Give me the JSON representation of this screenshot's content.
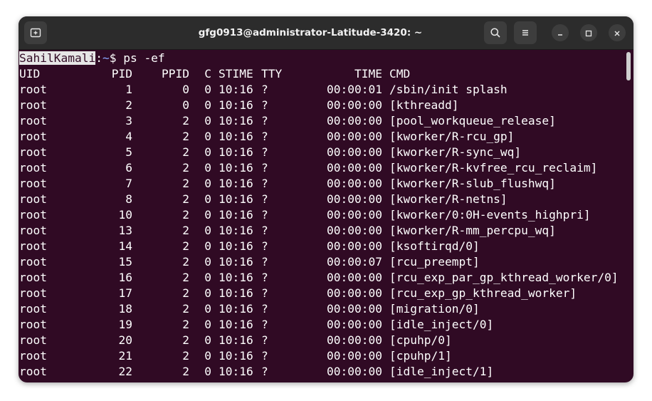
{
  "window": {
    "title": "gfg0913@administrator-Latitude-3420: ~"
  },
  "prompt": {
    "user": "SahilKamali",
    "sep": ":",
    "path": "~",
    "symbol": "$ ",
    "command": "ps -ef"
  },
  "table": {
    "headers": {
      "uid": "UID",
      "pid": "PID",
      "ppid": "PPID",
      "c": "C",
      "stime": "STIME",
      "tty": "TTY",
      "time": "TIME",
      "cmd": "CMD"
    },
    "rows": [
      {
        "uid": "root",
        "pid": "1",
        "ppid": "0",
        "c": "0",
        "stime": "10:16",
        "tty": "?",
        "time": "00:00:01",
        "cmd": "/sbin/init splash"
      },
      {
        "uid": "root",
        "pid": "2",
        "ppid": "0",
        "c": "0",
        "stime": "10:16",
        "tty": "?",
        "time": "00:00:00",
        "cmd": "[kthreadd]"
      },
      {
        "uid": "root",
        "pid": "3",
        "ppid": "2",
        "c": "0",
        "stime": "10:16",
        "tty": "?",
        "time": "00:00:00",
        "cmd": "[pool_workqueue_release]"
      },
      {
        "uid": "root",
        "pid": "4",
        "ppid": "2",
        "c": "0",
        "stime": "10:16",
        "tty": "?",
        "time": "00:00:00",
        "cmd": "[kworker/R-rcu_gp]"
      },
      {
        "uid": "root",
        "pid": "5",
        "ppid": "2",
        "c": "0",
        "stime": "10:16",
        "tty": "?",
        "time": "00:00:00",
        "cmd": "[kworker/R-sync_wq]"
      },
      {
        "uid": "root",
        "pid": "6",
        "ppid": "2",
        "c": "0",
        "stime": "10:16",
        "tty": "?",
        "time": "00:00:00",
        "cmd": "[kworker/R-kvfree_rcu_reclaim]"
      },
      {
        "uid": "root",
        "pid": "7",
        "ppid": "2",
        "c": "0",
        "stime": "10:16",
        "tty": "?",
        "time": "00:00:00",
        "cmd": "[kworker/R-slub_flushwq]"
      },
      {
        "uid": "root",
        "pid": "8",
        "ppid": "2",
        "c": "0",
        "stime": "10:16",
        "tty": "?",
        "time": "00:00:00",
        "cmd": "[kworker/R-netns]"
      },
      {
        "uid": "root",
        "pid": "10",
        "ppid": "2",
        "c": "0",
        "stime": "10:16",
        "tty": "?",
        "time": "00:00:00",
        "cmd": "[kworker/0:0H-events_highpri]"
      },
      {
        "uid": "root",
        "pid": "13",
        "ppid": "2",
        "c": "0",
        "stime": "10:16",
        "tty": "?",
        "time": "00:00:00",
        "cmd": "[kworker/R-mm_percpu_wq]"
      },
      {
        "uid": "root",
        "pid": "14",
        "ppid": "2",
        "c": "0",
        "stime": "10:16",
        "tty": "?",
        "time": "00:00:00",
        "cmd": "[ksoftirqd/0]"
      },
      {
        "uid": "root",
        "pid": "15",
        "ppid": "2",
        "c": "0",
        "stime": "10:16",
        "tty": "?",
        "time": "00:00:07",
        "cmd": "[rcu_preempt]"
      },
      {
        "uid": "root",
        "pid": "16",
        "ppid": "2",
        "c": "0",
        "stime": "10:16",
        "tty": "?",
        "time": "00:00:00",
        "cmd": "[rcu_exp_par_gp_kthread_worker/0]"
      },
      {
        "uid": "root",
        "pid": "17",
        "ppid": "2",
        "c": "0",
        "stime": "10:16",
        "tty": "?",
        "time": "00:00:00",
        "cmd": "[rcu_exp_gp_kthread_worker]"
      },
      {
        "uid": "root",
        "pid": "18",
        "ppid": "2",
        "c": "0",
        "stime": "10:16",
        "tty": "?",
        "time": "00:00:00",
        "cmd": "[migration/0]"
      },
      {
        "uid": "root",
        "pid": "19",
        "ppid": "2",
        "c": "0",
        "stime": "10:16",
        "tty": "?",
        "time": "00:00:00",
        "cmd": "[idle_inject/0]"
      },
      {
        "uid": "root",
        "pid": "20",
        "ppid": "2",
        "c": "0",
        "stime": "10:16",
        "tty": "?",
        "time": "00:00:00",
        "cmd": "[cpuhp/0]"
      },
      {
        "uid": "root",
        "pid": "21",
        "ppid": "2",
        "c": "0",
        "stime": "10:16",
        "tty": "?",
        "time": "00:00:00",
        "cmd": "[cpuhp/1]"
      },
      {
        "uid": "root",
        "pid": "22",
        "ppid": "2",
        "c": "0",
        "stime": "10:16",
        "tty": "?",
        "time": "00:00:00",
        "cmd": "[idle_inject/1]"
      }
    ]
  },
  "icons": {
    "new_tab": "new-tab-icon",
    "search": "search-icon",
    "menu": "hamburger-menu-icon",
    "minimize": "minimize-icon",
    "maximize": "maximize-icon",
    "close": "close-icon"
  },
  "colors": {
    "terminal_bg": "#300a24",
    "titlebar_bg": "#2c2c2c",
    "prompt_path": "#8aa6ff"
  }
}
